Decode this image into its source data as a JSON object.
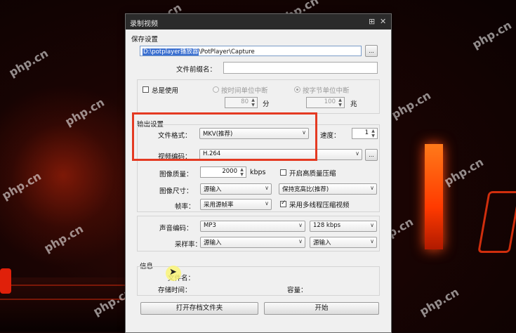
{
  "watermark": "php.cn",
  "window": {
    "title": "录制视频",
    "buttons": {
      "pin": "⊞",
      "close": "✕"
    }
  },
  "save_settings": {
    "label": "保存设置",
    "folder_value_highlight": "D:\\potplayer播放器",
    "folder_value_rest": "\\PotPlayer\\Capture",
    "browse_label": "...",
    "prefix_label": "文件前缀名：",
    "prefix_value": "",
    "always_use_label": "总是使用",
    "always_use_checked": false,
    "by_time_label": "按时间单位中断",
    "by_size_label": "按字节单位中断",
    "by_time_selected": false,
    "by_size_selected": true,
    "time_value": "80",
    "time_unit": "分",
    "size_value": "100",
    "size_unit": "兆"
  },
  "output_settings": {
    "label": "输出设置",
    "format_label": "文件格式：",
    "format_value": "MKV(推荐)",
    "speed_label": "速度：",
    "speed_value": "1",
    "video_codec_label": "视频编码：",
    "video_codec_value": "H.264",
    "codec_more_label": "...",
    "quality_label": "图像质量：",
    "quality_value": "2000",
    "quality_unit": "kbps",
    "hq_compress_label": "开启高质量压缩",
    "hq_compress_checked": false,
    "size_label": "图像尺寸：",
    "size_value": "源输入",
    "aspect_value": "保持宽高比(推荐)",
    "fps_label": "帧率：",
    "fps_value": "采用源帧率",
    "multithread_label": "采用多线程压缩视频",
    "multithread_checked": true,
    "audio_codec_label": "声音编码：",
    "audio_codec_value": "MP3",
    "audio_bitrate_value": "128 kbps",
    "sample_rate_label": "采样率：",
    "sample_rate_value": "源输入",
    "channels_value": "源输入"
  },
  "info": {
    "label": "信息",
    "filename_label": "文件名：",
    "time_label": "存储时间：",
    "capacity_label": "容量："
  },
  "buttons": {
    "open_folder": "打开存档文件夹",
    "start": "开始"
  },
  "colors": {
    "highlight_box": "#e43a22",
    "selection": "#3a6fd0",
    "titlebar": "#2b2b2b"
  }
}
